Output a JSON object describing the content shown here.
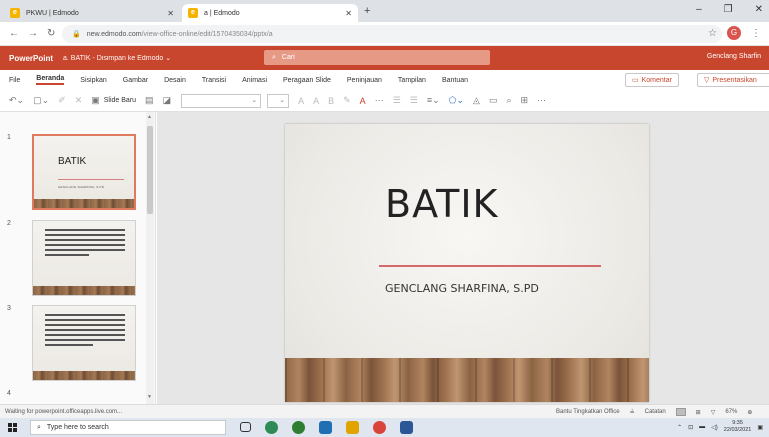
{
  "browser": {
    "tabs": [
      {
        "label": "PKWU | Edmodo",
        "active": false
      },
      {
        "label": "a | Edmodo",
        "active": true
      }
    ],
    "new_tab": "+",
    "url_host": "new.edmodo.com",
    "url_path": "/view-office-online/edit/1570435034/pptx/a"
  },
  "office": {
    "app_name": "PowerPoint",
    "doc_title": "a. BATIK  -  Disimpan ke Edmodo  ⌄",
    "search_placeholder": "Cari",
    "user_name": "Genclang Sharfin"
  },
  "menu": {
    "items": [
      "File",
      "Beranda",
      "Sisipkan",
      "Gambar",
      "Desain",
      "Transisi",
      "Animasi",
      "Peragaan Slide",
      "Peninjauan",
      "Tampilan",
      "Bantuan"
    ],
    "active": "Beranda",
    "komentar": "Komentar",
    "presentasikan": "Presentasikan"
  },
  "toolbar": {
    "new_slide": "Slide Baru"
  },
  "thumbnails": {
    "numbers": [
      "1",
      "2",
      "3",
      "4"
    ],
    "slide1_title": "BATIK",
    "slide1_sub": "GENCLANG SHARFINA, S.PD"
  },
  "slide": {
    "title": "BATIK",
    "subtitle": "GENCLANG SHARFINA, S.PD"
  },
  "status": {
    "left": "Waiting for powerpoint.officeapps.live.com...",
    "help": "Bantu Tingkatkan Office",
    "notes": "Catatan",
    "zoom": "67%"
  },
  "taskbar": {
    "search_placeholder": "Type here to search",
    "time": "9:35",
    "date": "22/03/2021"
  },
  "colors": {
    "accent": "#c8462d",
    "title_line": "#d26a6a"
  }
}
